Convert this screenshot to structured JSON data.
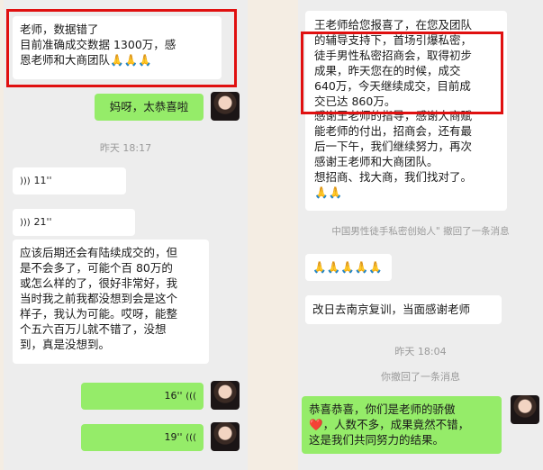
{
  "left": {
    "msg1_lines": [
      "老师，数据错了",
      "目前准确成交数据 1300万，感",
      "恩老师和大商团队🙏🙏🙏"
    ],
    "msg2": "妈呀，太恭喜啦",
    "time1": "昨天 18:17",
    "voice1": "11''",
    "voice2": "21''",
    "msg3_lines": [
      "应该后期还会有陆续成交的，但",
      "是不会多了，可能个百 80万的",
      "或怎么样的了，很好非常好，我",
      "当时我之前我都没想到会是这个",
      "样子，我认为可能。哎呀，能整",
      "个五六百万儿就不错了，没想",
      "到，真是没想到。"
    ],
    "voice3": "16''",
    "voice4": "19''"
  },
  "right": {
    "msg1_lines": [
      "王老师给您报喜了，在您及团队",
      "的辅导支持下，首场引爆私密，",
      "徒手男性私密招商会，取得初步",
      "成果，昨天您在的时候，成交",
      "640万，今天继续成交，目前成",
      "交已达 860万。",
      "感谢王老师的指导，感谢大商赋",
      "能老师的付出，招商会，还有最",
      "后一下午，我们继续努力，再次",
      "感谢王老师和大商团队。",
      "想招商、找大商，我们找对了。",
      "🙏🙏"
    ],
    "recall1": "中国男性徒手私密创始人\" 撤回了一条消息",
    "msg2": "🙏🙏🙏🙏🙏",
    "msg3": "改日去南京复训，当面感谢老师",
    "time1": "昨天 18:04",
    "recall2": "你撤回了一条消息",
    "msg4_lines": [
      "恭喜恭喜，你们是老师的骄傲",
      "❤️，人数不多，成果竟然不错，",
      "这是我们共同努力的结果。"
    ]
  }
}
